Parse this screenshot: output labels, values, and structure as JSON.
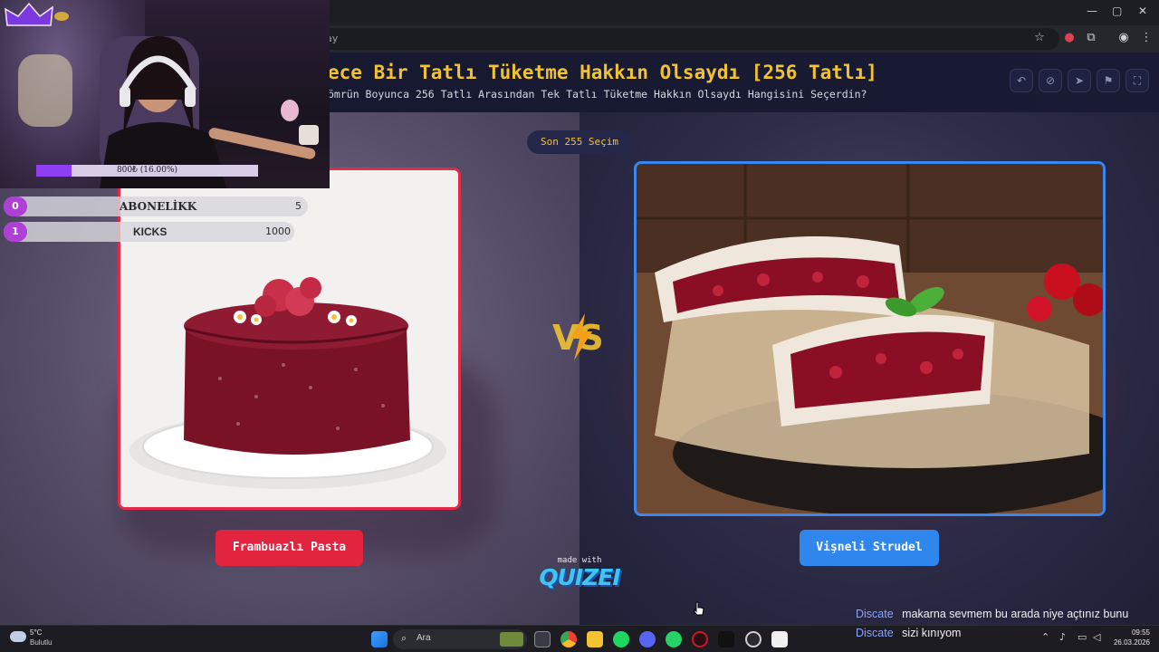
{
  "browser": {
    "url_fragment": "ay",
    "window_controls": [
      "—",
      "▢",
      "✕"
    ]
  },
  "quiz": {
    "title": "ece Bir Tatlı Tüketme Hakkın Olsaydı [256 Tatlı]",
    "subtitle": "ömrün Boyunca 256 Tatlı Arasından Tek Tatlı Tüketme Hakkın Olsaydı Hangisini Seçerdin?",
    "round_label": "Son 255 Seçim",
    "left_choice": "Frambuazlı Pasta",
    "right_choice": "Vişneli Strudel",
    "vs_label": "VS",
    "made_with": "made with",
    "brand": "QUIZEI"
  },
  "colors": {
    "accent_yellow": "#f2c230",
    "left_red": "#e3243f",
    "right_blue": "#2f86ec",
    "progress_purple": "#8f3ef2"
  },
  "webcam": {
    "progress_text": "800₺ (16.00%)",
    "progress_fraction": 0.16,
    "goals": [
      {
        "index": "0",
        "label": "ABONELİKK",
        "value": "5"
      },
      {
        "index": "1",
        "label": "KICKS",
        "value": "1000"
      }
    ]
  },
  "chat": [
    {
      "user": "Discate",
      "message": "makarna sevmem bu arada niye açtınız bunu"
    },
    {
      "user": "Discate",
      "message": "sizi kınıyom"
    }
  ],
  "taskbar": {
    "weather_temp": "5°C",
    "weather_desc": "Bulutlu",
    "search_label": "Ara",
    "time": "09:55",
    "date": "26.03.2026"
  }
}
